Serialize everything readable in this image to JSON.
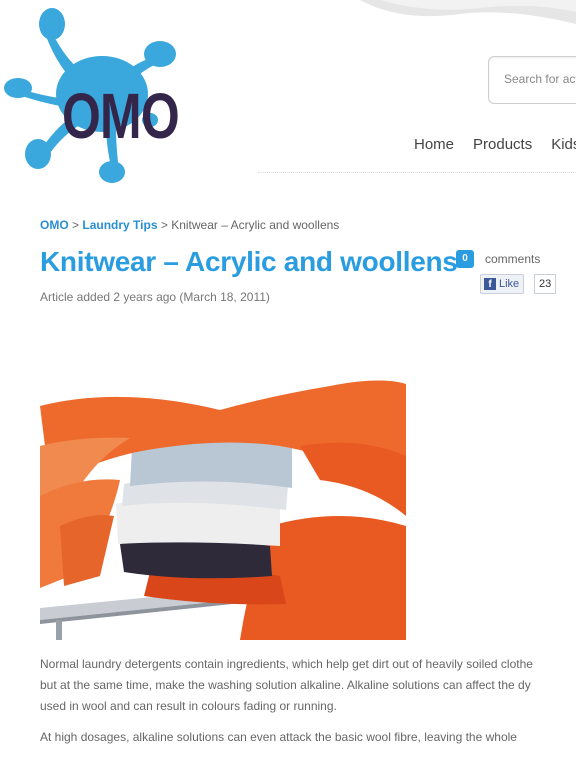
{
  "brand": {
    "logo_text": "OMO"
  },
  "search": {
    "placeholder": "Search for act"
  },
  "nav": {
    "items": [
      "Home",
      "Products",
      "Kids"
    ]
  },
  "breadcrumb": {
    "root": "OMO",
    "section": "Laundry Tips",
    "current": "Knitwear – Acrylic and woollens",
    "separator": ">"
  },
  "article": {
    "title": "Knitwear – Acrylic and woollens",
    "meta": "Article added 2 years ago (March 18, 2011)",
    "paragraph1": [
      "Normal laundry detergents contain ingredients, which help get dirt out of heavily soiled clothe",
      "but at the same time, make the washing solution alkaline. Alkaline solutions can affect the dy",
      "used in wool and can result in colours fading or running."
    ],
    "paragraph2": "At high dosages, alkaline solutions can even attack the basic wool fibre, leaving the whole"
  },
  "social": {
    "comment_count": "0",
    "comments_label": "comments",
    "like_label": "Like",
    "like_count": "23"
  },
  "colors": {
    "accent": "#2a9ce0",
    "logo_dark": "#33264a",
    "logo_splash": "#3aa7dd",
    "facebook": "#3b5998"
  },
  "icons": {
    "facebook": "facebook-icon"
  }
}
